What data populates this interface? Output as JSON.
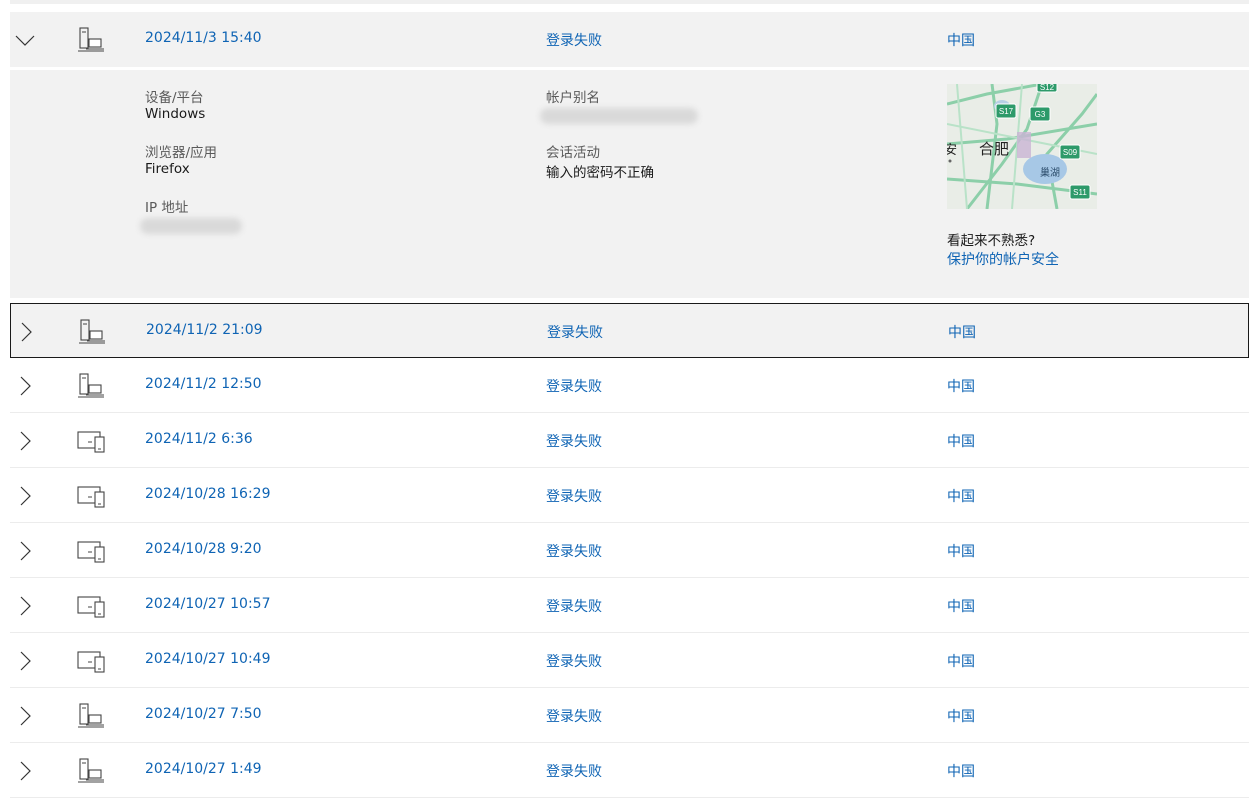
{
  "expanded": {
    "date": "2024/11/3 15:40",
    "status": "登录失败",
    "country": "中国",
    "device_label": "设备/平台",
    "device_value": "Windows",
    "browser_label": "浏览器/应用",
    "browser_value": "Firefox",
    "ip_label": "IP 地址",
    "alias_label": "帐户别名",
    "activity_label": "会话活动",
    "activity_value": "输入的密码不正确",
    "map": {
      "city": "合肥",
      "partial_label": "安",
      "lake": "巢湖",
      "shields": [
        "S12",
        "S17",
        "G3",
        "S09",
        "S11"
      ]
    },
    "unfamiliar_text": "看起来不熟悉?",
    "protect_link": "保护你的帐户安全"
  },
  "rows": [
    {
      "date": "2024/11/2 21:09",
      "status": "登录失败",
      "country": "中国",
      "device": "desktop-laptop-icon"
    },
    {
      "date": "2024/11/2 12:50",
      "status": "登录失败",
      "country": "中国",
      "device": "desktop-laptop-icon"
    },
    {
      "date": "2024/11/2 6:36",
      "status": "登录失败",
      "country": "中国",
      "device": "laptop-phone-icon"
    },
    {
      "date": "2024/10/28 16:29",
      "status": "登录失败",
      "country": "中国",
      "device": "laptop-phone-icon"
    },
    {
      "date": "2024/10/28 9:20",
      "status": "登录失败",
      "country": "中国",
      "device": "laptop-phone-icon"
    },
    {
      "date": "2024/10/27 10:57",
      "status": "登录失败",
      "country": "中国",
      "device": "laptop-phone-icon"
    },
    {
      "date": "2024/10/27 10:49",
      "status": "登录失败",
      "country": "中国",
      "device": "laptop-phone-icon"
    },
    {
      "date": "2024/10/27 7:50",
      "status": "登录失败",
      "country": "中国",
      "device": "desktop-laptop-icon"
    },
    {
      "date": "2024/10/27 1:49",
      "status": "登录失败",
      "country": "中国",
      "device": "desktop-laptop-icon"
    }
  ]
}
